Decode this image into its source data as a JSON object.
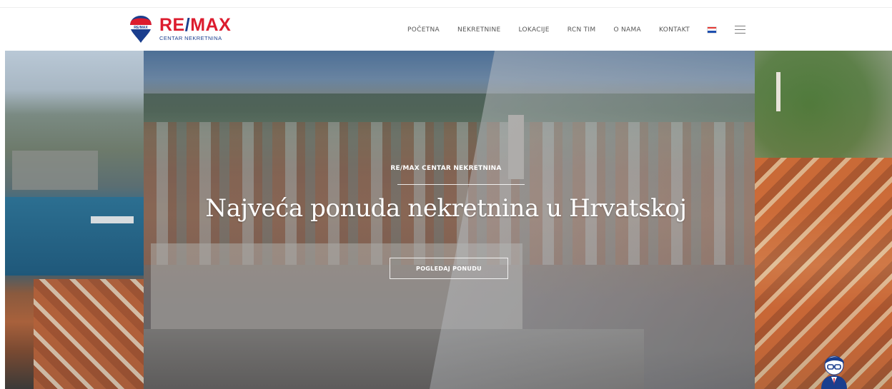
{
  "brand": {
    "name_part1": "RE",
    "name_slash": "/",
    "name_part2": "MAX",
    "subtitle": "CENTAR NEKRETNINA",
    "balloon_text": "RE/MAX",
    "primary_red": "#dc1c2e",
    "primary_blue": "#1a3e8e"
  },
  "nav": {
    "items": [
      {
        "label": "POČETNA"
      },
      {
        "label": "NEKRETNINE"
      },
      {
        "label": "LOKACIJE"
      },
      {
        "label": "RCN TIM"
      },
      {
        "label": "O NAMA"
      },
      {
        "label": "KONTAKT"
      }
    ],
    "language_flag": "croatia-flag-icon",
    "menu_icon": "hamburger-menu-icon"
  },
  "hero": {
    "eyebrow": "RE/MAX CENTAR NEKRETNINA",
    "headline": "Najveća ponuda nekretnina u Hrvatskoj",
    "cta_label": "POGLEDAJ PONUDU",
    "mascot_icon": "agent-avatar-icon"
  }
}
